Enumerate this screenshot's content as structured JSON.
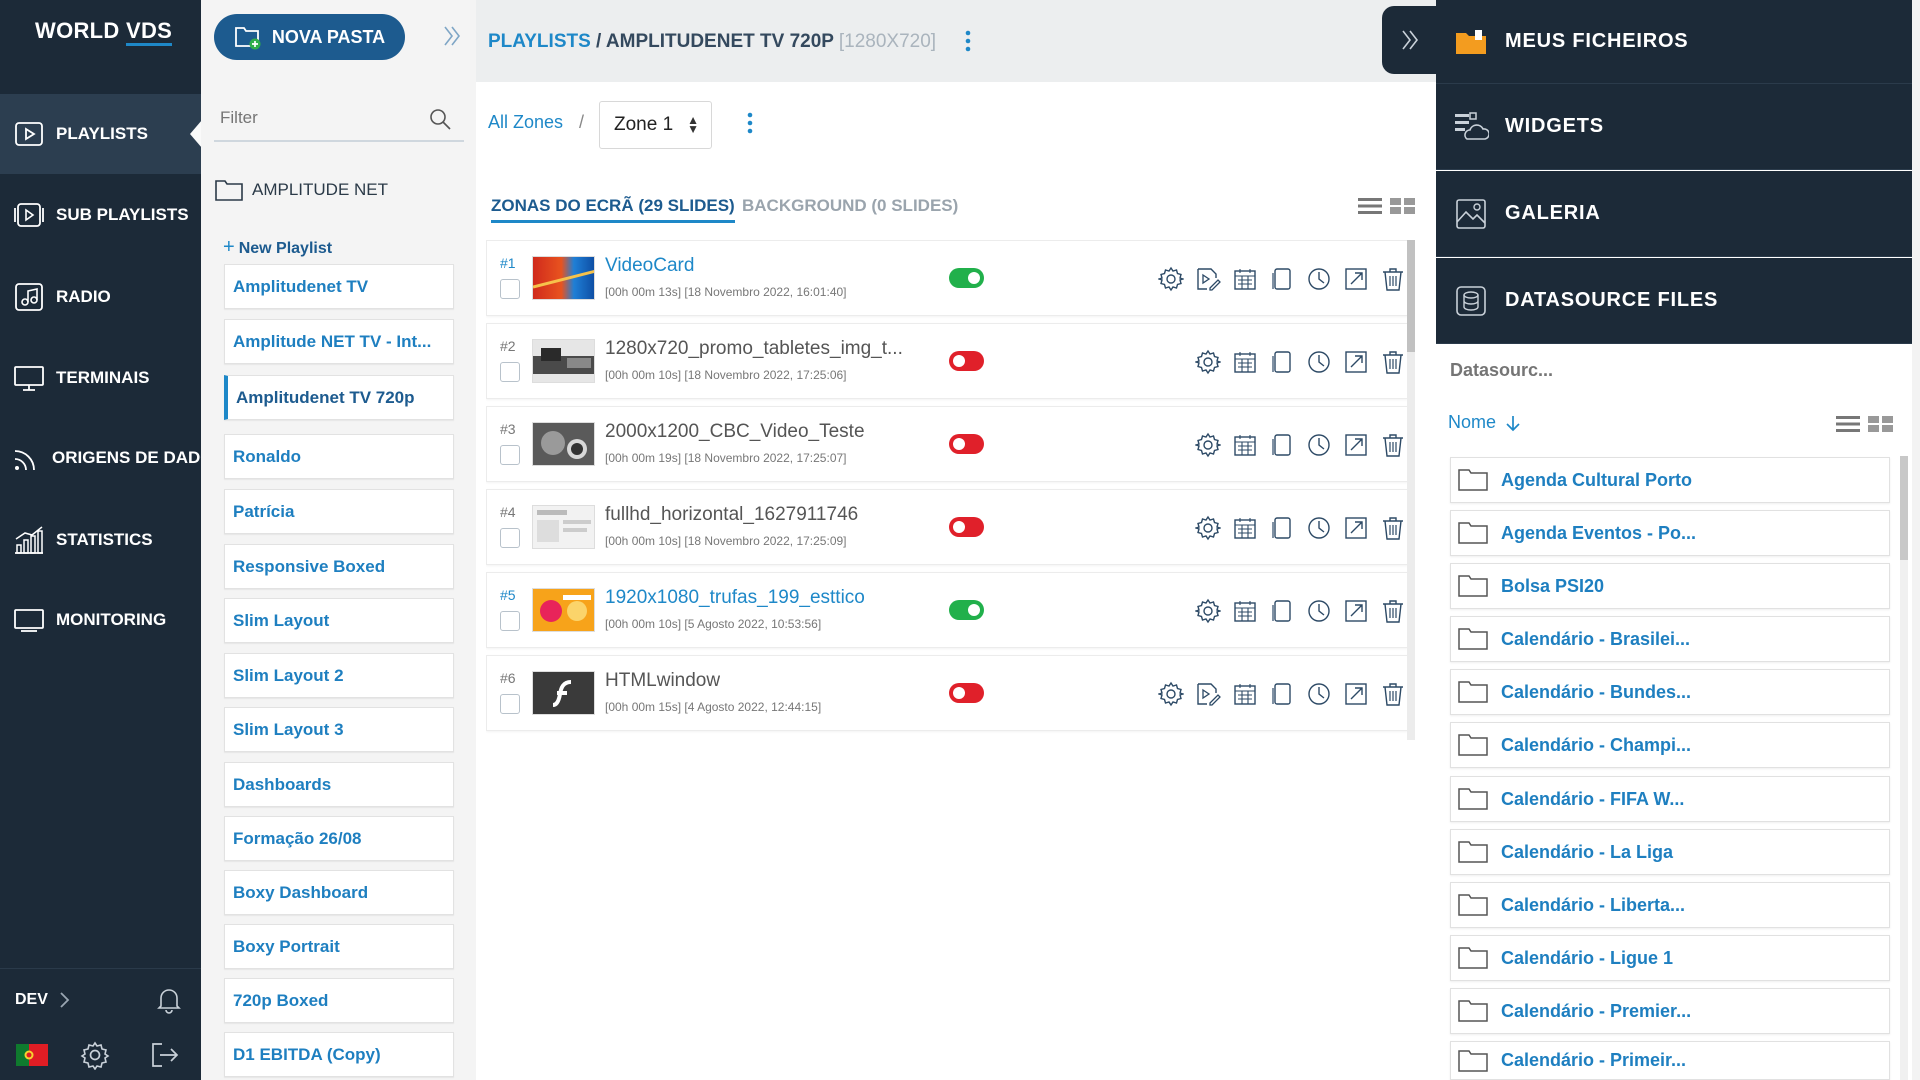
{
  "app": {
    "logo_part1": "WORLD",
    "logo_part2": "VDS"
  },
  "nav": {
    "items": [
      {
        "label": "PLAYLISTS",
        "icon": "play-icon",
        "active": true
      },
      {
        "label": "SUB PLAYLISTS",
        "icon": "sub-playlists-icon"
      },
      {
        "label": "RADIO",
        "icon": "radio-icon"
      },
      {
        "label": "TERMINAIS",
        "icon": "monitor-icon"
      },
      {
        "label": "ORIGENS DE DADOS",
        "icon": "data-source-icon"
      },
      {
        "label": "STATISTICS",
        "icon": "chart-icon"
      },
      {
        "label": "MONITORING",
        "icon": "monitoring-icon"
      }
    ],
    "env": "DEV",
    "bottom_icons": [
      "portugal-flag-icon",
      "gear-icon",
      "logout-icon",
      "bell-icon"
    ]
  },
  "playlist_panel": {
    "new_folder": "NOVA PASTA",
    "filter_placeholder": "Filter",
    "folder": "AMPLITUDE NET",
    "new_playlist": "New Playlist",
    "items": [
      "Amplitudenet TV",
      "Amplitude NET TV - Int...",
      "Amplitudenet TV 720p",
      "Ronaldo",
      "Patrícia",
      "Responsive Boxed",
      "Slim Layout",
      "Slim Layout 2",
      "Slim Layout 3",
      "Dashboards",
      "Formação 26/08",
      "Boxy Dashboard",
      "Boxy Portrait",
      "720p Boxed",
      "D1 EBITDA (Copy)"
    ],
    "active_index": 2
  },
  "main": {
    "breadcrumb": {
      "root": "PLAYLISTS",
      "sep": " / ",
      "name": "AMPLITUDENET TV 720P",
      "res": "[1280X720]"
    },
    "zones_link": "All Zones",
    "zones_sep": "/",
    "zone_selected": "Zone 1",
    "tabs": [
      {
        "label": "ZONAS DO ECRÃ (29 SLIDES)",
        "active": true
      },
      {
        "label": "BACKGROUND (0 SLIDES)",
        "active": false
      }
    ],
    "slides": [
      {
        "num": "#1",
        "title": "VideoCard",
        "meta": "[00h 00m 13s] [18 Novembro 2022, 16:01:40]",
        "enabled": true,
        "thumb": "video-thumb"
      },
      {
        "num": "#2",
        "title": "1280x720_promo_tabletes_img_t...",
        "meta": "[00h 00m 10s] [18 Novembro 2022, 17:25:06]",
        "enabled": false,
        "thumb": "promo-thumb"
      },
      {
        "num": "#3",
        "title": "2000x1200_CBC_Video_Teste",
        "meta": "[00h 00m 19s] [18 Novembro 2022, 17:25:07]",
        "enabled": false,
        "thumb": "cbc-thumb"
      },
      {
        "num": "#4",
        "title": "fullhd_horizontal_1627911746",
        "meta": "[00h 00m 10s] [18 Novembro 2022, 17:25:09]",
        "enabled": false,
        "thumb": "fullhd-thumb"
      },
      {
        "num": "#5",
        "title": "1920x1080_trufas_199_esttico",
        "meta": "[00h 00m 10s] [5 Agosto 2022, 10:53:56]",
        "enabled": true,
        "thumb": "trufas-thumb"
      },
      {
        "num": "#6",
        "title": "HTMLwindow",
        "meta": "[00h 00m 15s] [4 Agosto 2022, 12:44:15]",
        "enabled": false,
        "thumb": "flash-thumb"
      }
    ]
  },
  "right_panel": {
    "sections": [
      {
        "label": "MEUS FICHEIROS",
        "icon": "folder-icon"
      },
      {
        "label": "WIDGETS",
        "icon": "widgets-icon"
      },
      {
        "label": "GALERIA",
        "icon": "gallery-icon"
      },
      {
        "label": "DATASOURCE FILES",
        "icon": "database-icon"
      }
    ],
    "search_placeholder": "Datasourc...",
    "sort_label": "Nome",
    "items": [
      "Agenda Cultural Porto",
      "Agenda Eventos - Po...",
      "Bolsa PSI20",
      "Calendário - Brasilei...",
      "Calendário - Bundes...",
      "Calendário - Champi...",
      "Calendário - FIFA W...",
      "Calendário - La Liga",
      "Calendário - Liberta...",
      "Calendário - Ligue 1",
      "Calendário - Premier...",
      "Calendário - Primeir..."
    ]
  },
  "colors": {
    "nav_bg": "#1c2a38",
    "accent": "#1e88c8",
    "button": "#1d5b8f",
    "toggle_on": "#21b04b",
    "toggle_off": "#e0202a"
  }
}
